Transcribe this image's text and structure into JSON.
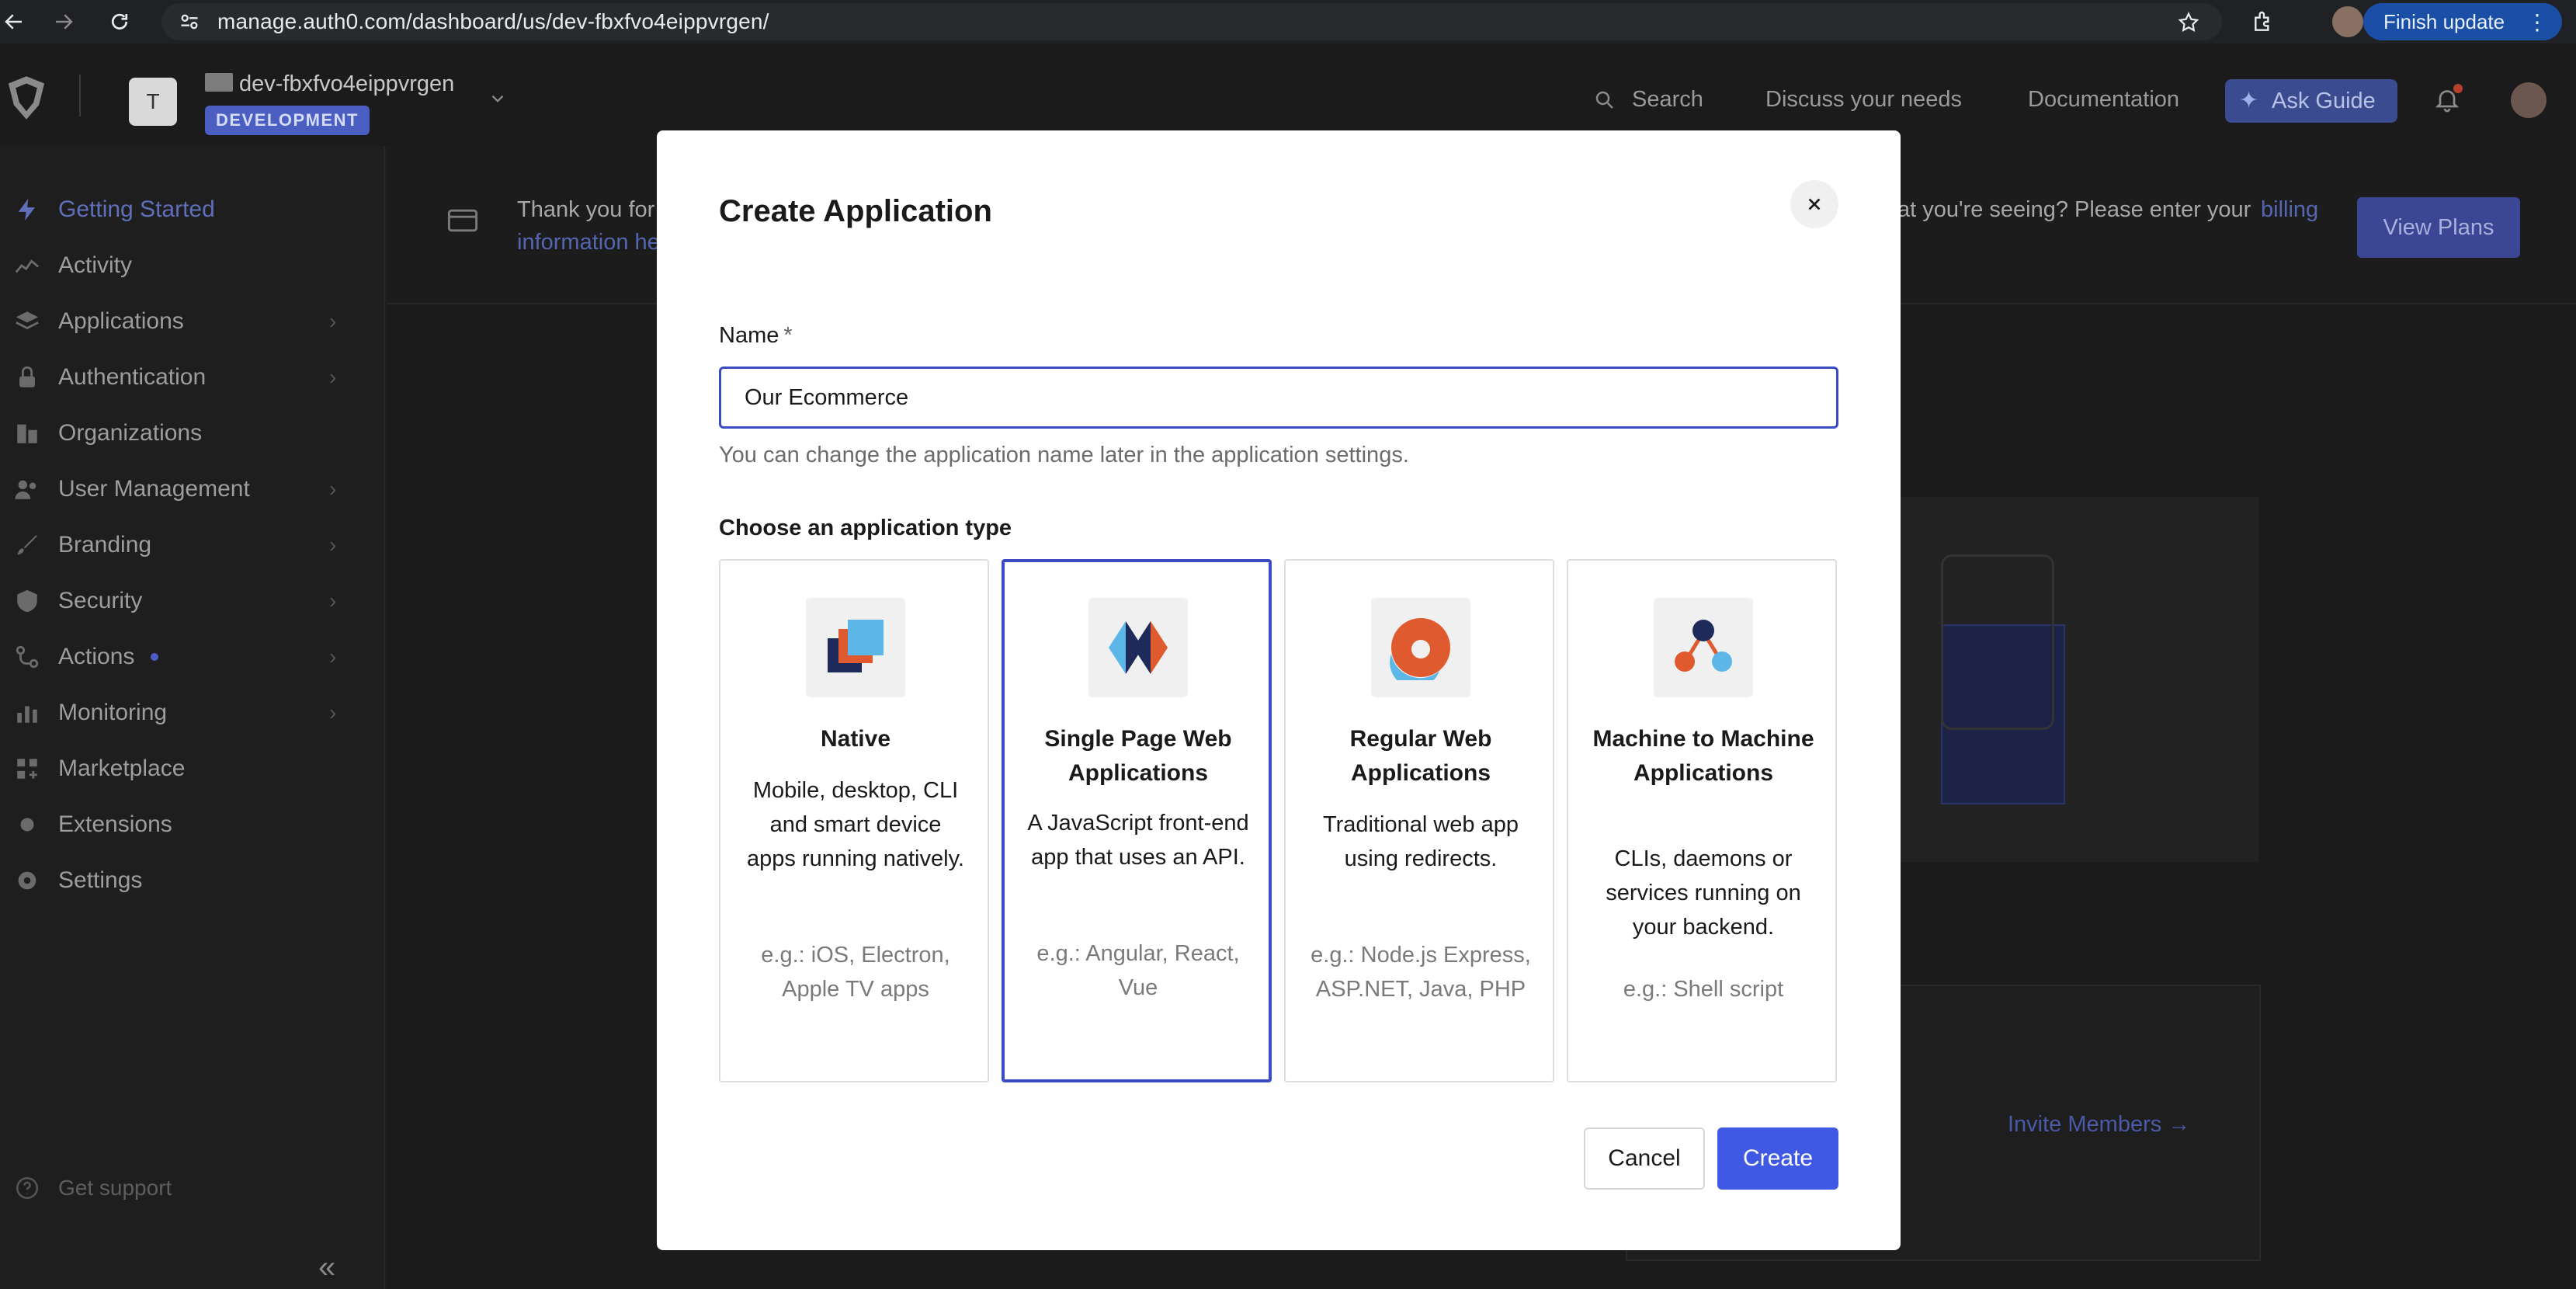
{
  "browser": {
    "url": "manage.auth0.com/dashboard/us/dev-fbxfvo4eippvrgen/",
    "finish_update": "Finish update"
  },
  "header": {
    "tenant_initial": "T",
    "tenant_name": "dev-fbxfvo4eippvrgen",
    "env_badge": "DEVELOPMENT",
    "search": "Search",
    "discuss": "Discuss your needs",
    "docs": "Documentation",
    "ask_guide": "Ask Guide"
  },
  "sidebar": {
    "items": [
      {
        "label": "Getting Started",
        "icon": "bolt-icon",
        "chevron": false
      },
      {
        "label": "Activity",
        "icon": "activity-icon",
        "chevron": false
      },
      {
        "label": "Applications",
        "icon": "layers-icon",
        "chevron": true
      },
      {
        "label": "Authentication",
        "icon": "lock-icon",
        "chevron": true
      },
      {
        "label": "Organizations",
        "icon": "building-icon",
        "chevron": false
      },
      {
        "label": "User Management",
        "icon": "users-icon",
        "chevron": true
      },
      {
        "label": "Branding",
        "icon": "brush-icon",
        "chevron": true
      },
      {
        "label": "Security",
        "icon": "shield-icon",
        "chevron": true
      },
      {
        "label": "Actions",
        "icon": "flow-icon",
        "chevron": true
      },
      {
        "label": "Monitoring",
        "icon": "bar-chart-icon",
        "chevron": true
      },
      {
        "label": "Marketplace",
        "icon": "grid-plus-icon",
        "chevron": false
      },
      {
        "label": "Extensions",
        "icon": "puzzle-icon",
        "chevron": false
      },
      {
        "label": "Settings",
        "icon": "gear-icon",
        "chevron": false
      }
    ],
    "get_support": "Get support",
    "collapse": "«"
  },
  "banner": {
    "text_left_1": "Thank you for",
    "text_left_2": "information he",
    "text_right": "at you're seeing? Please enter your",
    "link_right": "billing",
    "view_plans": "View Plans"
  },
  "background": {
    "invite_members": "Invite Members →"
  },
  "modal": {
    "title": "Create Application",
    "name_label": "Name",
    "required_mark": "*",
    "name_value": "Our Ecommerce",
    "name_help": "You can change the application name later in the application settings.",
    "type_label": "Choose an application type",
    "types": [
      {
        "title": "Native",
        "desc": "Mobile, desktop, CLI and smart device apps running natively.",
        "example": "e.g.: iOS, Electron, Apple TV apps",
        "icon": "native-app-icon",
        "selected": false
      },
      {
        "title": "Single Page Web Applications",
        "desc": "A JavaScript front-end app that uses an API.",
        "example": "e.g.: Angular, React, Vue",
        "icon": "spa-icon",
        "selected": true
      },
      {
        "title": "Regular Web Applications",
        "desc": "Traditional web app using redirects.",
        "example": "e.g.: Node.js Express, ASP.NET, Java, PHP",
        "icon": "regular-web-app-icon",
        "selected": false
      },
      {
        "title": "Machine to Machine Applications",
        "desc": "CLIs, daemons or services running on your backend.",
        "example": "e.g.: Shell script",
        "icon": "m2m-icon",
        "selected": false
      }
    ],
    "cancel": "Cancel",
    "create": "Create"
  },
  "colors": {
    "accent": "#3f59e4",
    "selected_border": "#3b4cc0",
    "overlay": "#1b1b1b"
  }
}
